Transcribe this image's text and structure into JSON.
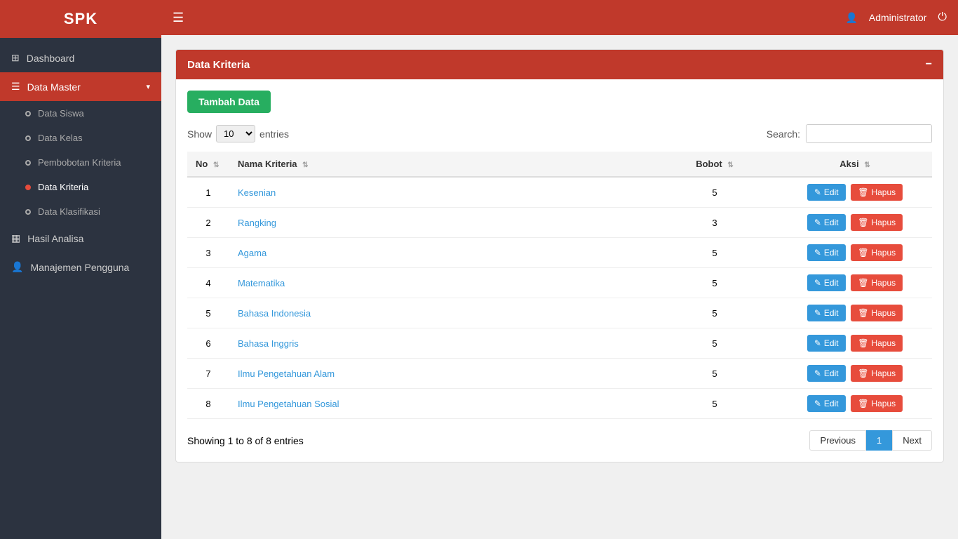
{
  "app": {
    "title": "SPK"
  },
  "topbar": {
    "user_label": "Administrator"
  },
  "sidebar": {
    "items": [
      {
        "id": "dashboard",
        "label": "Dashboard",
        "icon": "grid"
      },
      {
        "id": "data-master",
        "label": "Data Master",
        "icon": "list",
        "hasDropdown": true,
        "expanded": true
      },
      {
        "id": "hasil-analisa",
        "label": "Hasil Analisa",
        "icon": "chart"
      },
      {
        "id": "manajemen-pengguna",
        "label": "Manajemen Pengguna",
        "icon": "users"
      }
    ],
    "submenu": [
      {
        "id": "data-siswa",
        "label": "Data Siswa"
      },
      {
        "id": "data-kelas",
        "label": "Data Kelas"
      },
      {
        "id": "pembobotan-kriteria",
        "label": "Pembobotan Kriteria"
      },
      {
        "id": "data-kriteria",
        "label": "Data Kriteria",
        "active": true
      },
      {
        "id": "data-klasifikasi",
        "label": "Data Klasifikasi"
      }
    ]
  },
  "page": {
    "title": "Data Kriteria",
    "add_button": "Tambah Data",
    "show_label": "Show",
    "entries_label": "entries",
    "search_label": "Search:",
    "entries_value": "10"
  },
  "table": {
    "columns": [
      {
        "key": "no",
        "label": "No"
      },
      {
        "key": "nama_kriteria",
        "label": "Nama Kriteria"
      },
      {
        "key": "bobot",
        "label": "Bobot"
      },
      {
        "key": "aksi",
        "label": "Aksi"
      }
    ],
    "rows": [
      {
        "no": 1,
        "nama": "Kesenian",
        "bobot": 5
      },
      {
        "no": 2,
        "nama": "Rangking",
        "bobot": 3
      },
      {
        "no": 3,
        "nama": "Agama",
        "bobot": 5
      },
      {
        "no": 4,
        "nama": "Matematika",
        "bobot": 5
      },
      {
        "no": 5,
        "nama": "Bahasa Indonesia",
        "bobot": 5
      },
      {
        "no": 6,
        "nama": "Bahasa Inggris",
        "bobot": 5
      },
      {
        "no": 7,
        "nama": "Ilmu Pengetahuan Alam",
        "bobot": 5
      },
      {
        "no": 8,
        "nama": "Ilmu Pengetahuan Sosial",
        "bobot": 5
      }
    ],
    "edit_label": "Edit",
    "hapus_label": "Hapus"
  },
  "pagination": {
    "showing_text": "Showing 1 to 8 of 8 entries",
    "previous_label": "Previous",
    "next_label": "Next",
    "current_page": 1
  }
}
